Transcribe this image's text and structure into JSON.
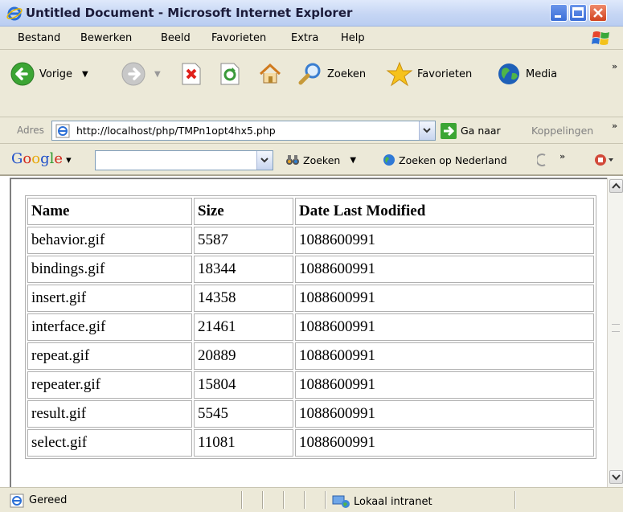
{
  "window": {
    "title": "Untitled Document - Microsoft Internet Explorer"
  },
  "menu": {
    "items": [
      "Bestand",
      "Bewerken",
      "Beeld",
      "Favorieten",
      "Extra",
      "Help"
    ]
  },
  "toolbar": {
    "back_label": "Vorige",
    "search_label": "Zoeken",
    "favorites_label": "Favorieten",
    "media_label": "Media",
    "overflow": "»"
  },
  "address": {
    "label": "Adres",
    "url": "http://localhost/php/TMPn1opt4hx5.php",
    "go_label": "Ga naar",
    "links_label": "Koppelingen",
    "overflow": "»"
  },
  "google": {
    "logo": "Google",
    "search_value": "",
    "search_label": "Zoeken",
    "search_nl_label": "Zoeken op Nederland",
    "overflow": "»"
  },
  "table": {
    "headers": [
      "Name",
      "Size",
      "Date Last Modified"
    ],
    "rows": [
      [
        "behavior.gif",
        "5587",
        "1088600991"
      ],
      [
        "bindings.gif",
        "18344",
        "1088600991"
      ],
      [
        "insert.gif",
        "14358",
        "1088600991"
      ],
      [
        "interface.gif",
        "21461",
        "1088600991"
      ],
      [
        "repeat.gif",
        "20889",
        "1088600991"
      ],
      [
        "repeater.gif",
        "15804",
        "1088600991"
      ],
      [
        "result.gif",
        "5545",
        "1088600991"
      ],
      [
        "select.gif",
        "11081",
        "1088600991"
      ]
    ]
  },
  "status": {
    "text": "Gereed",
    "zone": "Lokaal intranet"
  },
  "colors": {
    "titlebar": "#c6d6f4",
    "chrome": "#ece9d8",
    "close_button": "#d1431e"
  }
}
